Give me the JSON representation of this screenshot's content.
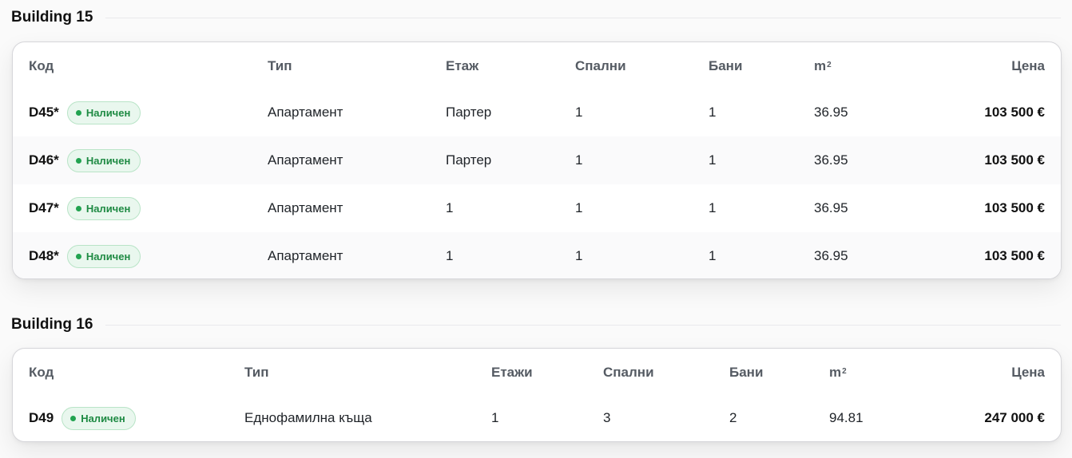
{
  "colors": {
    "available_badge_text": "#1e8a43",
    "available_badge_bg": "#e9f7ee",
    "available_dot": "#22a350"
  },
  "buildings": [
    {
      "title": "Building 15",
      "headers": {
        "code": "Код",
        "type": "Тип",
        "floor": "Етаж",
        "bedrooms": "Спални",
        "bathrooms": "Бани",
        "area": "m",
        "area_sup": "2",
        "price": "Цена"
      },
      "rows": [
        {
          "code": "D45*",
          "status": "Наличен",
          "type": "Апартамент",
          "floor": "Партер",
          "bedrooms": "1",
          "bathrooms": "1",
          "area": "36.95",
          "price": "103 500 €"
        },
        {
          "code": "D46*",
          "status": "Наличен",
          "type": "Апартамент",
          "floor": "Партер",
          "bedrooms": "1",
          "bathrooms": "1",
          "area": "36.95",
          "price": "103 500 €"
        },
        {
          "code": "D47*",
          "status": "Наличен",
          "type": "Апартамент",
          "floor": "1",
          "bedrooms": "1",
          "bathrooms": "1",
          "area": "36.95",
          "price": "103 500 €"
        },
        {
          "code": "D48*",
          "status": "Наличен",
          "type": "Апартамент",
          "floor": "1",
          "bedrooms": "1",
          "bathrooms": "1",
          "area": "36.95",
          "price": "103 500 €"
        }
      ]
    },
    {
      "title": "Building 16",
      "headers": {
        "code": "Код",
        "type": "Тип",
        "floor": "Етажи",
        "bedrooms": "Спални",
        "bathrooms": "Бани",
        "area": "m",
        "area_sup": "2",
        "price": "Цена"
      },
      "rows": [
        {
          "code": "D49",
          "status": "Наличен",
          "type": "Еднофамилна къща",
          "floor": "1",
          "bedrooms": "3",
          "bathrooms": "2",
          "area": "94.81",
          "price": "247 000 €"
        }
      ]
    }
  ]
}
